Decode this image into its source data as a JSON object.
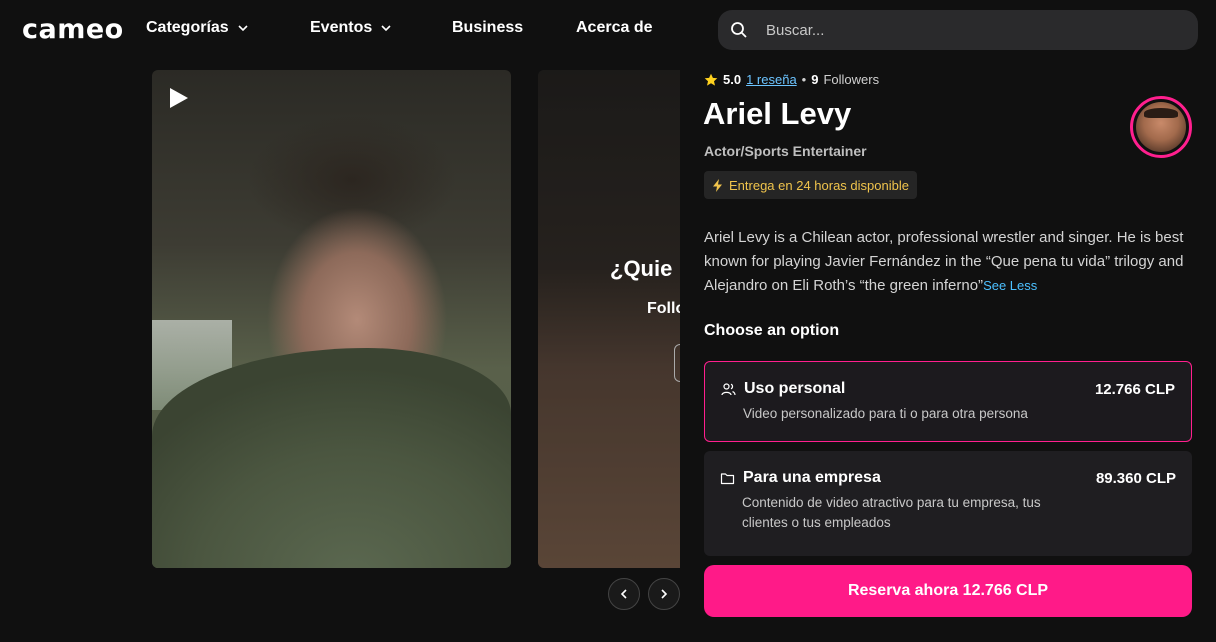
{
  "header": {
    "logo": "cameo",
    "nav": [
      {
        "label": "Categorías",
        "has_dropdown": true
      },
      {
        "label": "Eventos",
        "has_dropdown": true
      },
      {
        "label": "Business",
        "has_dropdown": false
      },
      {
        "label": "Acerca de",
        "has_dropdown": false
      }
    ],
    "search_placeholder": "Buscar..."
  },
  "video": {
    "second_title": "¿Quie",
    "second_sub": "Follo"
  },
  "profile": {
    "rating": "5.0",
    "reviews_link": "1 reseña",
    "separator": "•",
    "followers_count": "9",
    "followers_label": "Followers",
    "name": "Ariel Levy",
    "role": "Actor/Sports Entertainer",
    "delivery": "Entrega en 24 horas disponible",
    "bio": "Ariel Levy is a Chilean actor, professional wrestler and singer. He is best known for playing Javier Fernández in the “Que pena tu vida” trilogy and Alejandro on Eli Roth’s “the green inferno”",
    "see_less": "See Less"
  },
  "options": {
    "heading": "Choose an option",
    "items": [
      {
        "title": "Uso personal",
        "price": "12.766 CLP",
        "description": "Video personalizado para ti o para otra persona",
        "icon": "users-icon",
        "selected": true
      },
      {
        "title": "Para una empresa",
        "price": "89.360 CLP",
        "description": "Contenido de video atractivo para tu empresa, tus clientes o tus empleados",
        "icon": "folder-icon",
        "selected": false
      }
    ]
  },
  "cta": {
    "label": "Reserva ahora 12.766 CLP"
  },
  "colors": {
    "accent": "#ff1a88",
    "link": "#4cc0ff",
    "delivery": "#f0c44c",
    "background": "#101010"
  }
}
